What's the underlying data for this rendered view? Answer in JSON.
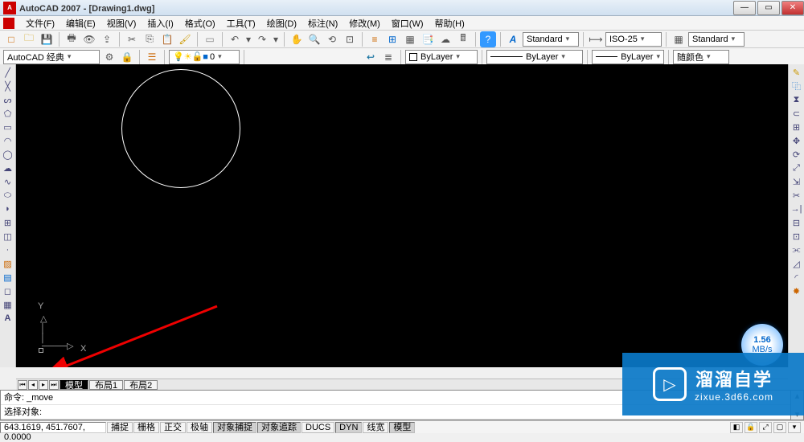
{
  "titlebar": {
    "app": "AutoCAD 2007",
    "file": "[Drawing1.dwg]"
  },
  "menu": {
    "file": "文件(F)",
    "edit": "编辑(E)",
    "view": "视图(V)",
    "insert": "插入(I)",
    "format": "格式(O)",
    "tools": "工具(T)",
    "draw": "绘图(D)",
    "dimension": "标注(N)",
    "modify": "修改(M)",
    "window": "窗口(W)",
    "help": "帮助(H)"
  },
  "styles": {
    "textstyle": "Standard",
    "dimstyle": "ISO-25",
    "tablestyle": "Standard"
  },
  "workspace_combo": "AutoCAD 经典",
  "layers": {
    "current": "0",
    "layer_display": "0"
  },
  "properties": {
    "color": "ByLayer",
    "linetype": "ByLayer",
    "lineweight": "ByLayer",
    "plotstyle": "随颜色"
  },
  "tabs": {
    "model": "模型",
    "layout1": "布局1",
    "layout2": "布局2"
  },
  "command": {
    "line1": "命令: _move",
    "line2": "选择对象:"
  },
  "status": {
    "coords": "643.1619, 451.7607, 0.0000",
    "snap": "捕捉",
    "grid": "栅格",
    "ortho": "正交",
    "polar": "极轴",
    "osnap": "对象捕捉",
    "otrack": "对象追踪",
    "ducs": "DUCS",
    "dyn": "DYN",
    "lwt": "线宽",
    "model": "模型"
  },
  "speed": {
    "value": "1.56",
    "unit": "MB/s"
  },
  "watermark": {
    "main": "溜溜自学",
    "sub": "zixue.3d66.com"
  },
  "icons": {
    "new": "□",
    "open": "📂",
    "save": "💾",
    "plot": "🖨",
    "cut": "✂",
    "copy": "⎘",
    "paste": "📋",
    "undo": "↶",
    "redo": "↷",
    "pan": "✋",
    "zoom": "🔍",
    "help": "?"
  }
}
